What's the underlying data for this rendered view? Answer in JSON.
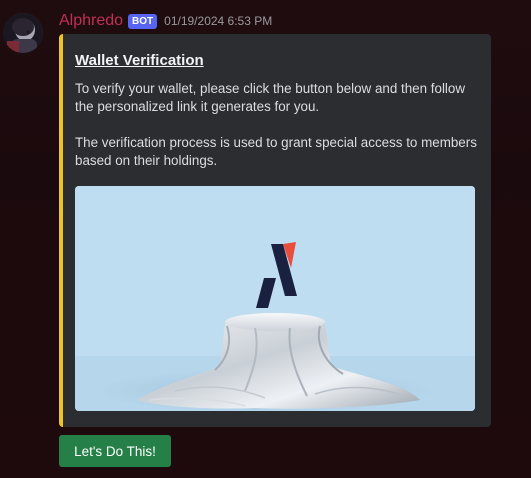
{
  "message": {
    "author": {
      "username": "Alphredo",
      "bot_tag": "BOT",
      "name_color": "#c02f54"
    },
    "timestamp": "01/19/2024 6:53 PM",
    "embed": {
      "accent_color": "#f0c420",
      "title": "Wallet Verification",
      "description": [
        "To verify your wallet, please click the button below and then follow the personalized link it generates for you.",
        "The verification process is used to grant special access to members based on their holdings."
      ],
      "image": {
        "subject": "logo-on-draped-pedestal",
        "logo_colors": [
          "#1a2140",
          "#e94e3c"
        ]
      }
    },
    "components": {
      "primary_button_label": "Let's Do This!",
      "primary_button_color": "#248046"
    }
  }
}
